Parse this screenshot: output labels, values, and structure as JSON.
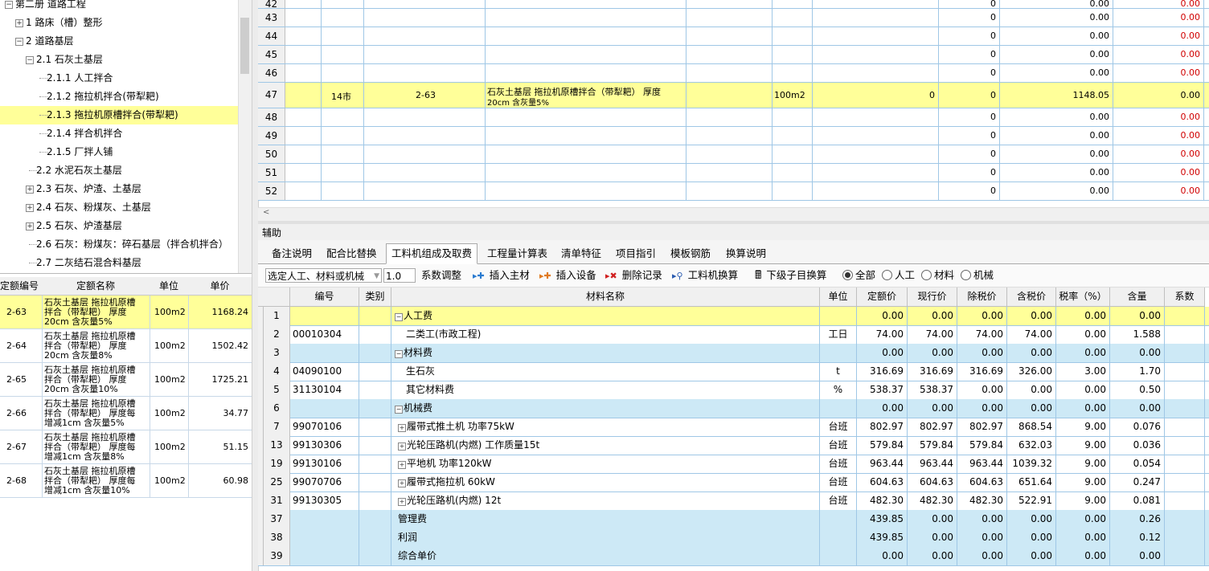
{
  "tree": {
    "items": [
      {
        "label": "第二册 道路工程",
        "expander": "⊟"
      },
      {
        "label": "1 路床（槽）整形",
        "expander": "⊞"
      },
      {
        "label": "2 道路基层",
        "expander": "⊟"
      },
      {
        "label": "2.1 石灰土基层",
        "expander": "⊟"
      },
      {
        "label": "2.1.1 人工拌合",
        "expander": ""
      },
      {
        "label": "2.1.2 拖拉机拌合(带犁耙)",
        "expander": ""
      },
      {
        "label": "2.1.3 拖拉机原槽拌合(带犁耙)",
        "expander": ""
      },
      {
        "label": "2.1.4 拌合机拌合",
        "expander": ""
      },
      {
        "label": "2.1.5 厂拌人铺",
        "expander": ""
      },
      {
        "label": "2.2 水泥石灰土基层",
        "expander": ""
      },
      {
        "label": "2.3 石灰、炉渣、土基层",
        "expander": "⊞"
      },
      {
        "label": "2.4 石灰、粉煤灰、土基层",
        "expander": "⊞"
      },
      {
        "label": "2.5 石灰、炉渣基层",
        "expander": "⊞"
      },
      {
        "label": "2.6 石灰：粉煤灰：碎石基层（拌合机拌合）",
        "expander": ""
      },
      {
        "label": "2.7 二灰结石混合料基层",
        "expander": ""
      }
    ]
  },
  "quota": {
    "headers": [
      "定额编号",
      "定额名称",
      "单位",
      "单价"
    ],
    "rows": [
      {
        "code": "2-63",
        "name1": "石灰土基层 拖拉机原槽",
        "name2": "拌合（带犁耙） 厚度",
        "name3": "20cm 含灰量5%",
        "unit": "100m2",
        "price": "1168.24"
      },
      {
        "code": "2-64",
        "name1": "石灰土基层 拖拉机原槽",
        "name2": "拌合（带犁耙） 厚度",
        "name3": "20cm 含灰量8%",
        "unit": "100m2",
        "price": "1502.42"
      },
      {
        "code": "2-65",
        "name1": "石灰土基层 拖拉机原槽",
        "name2": "拌合（带犁耙） 厚度",
        "name3": "20cm 含灰量10%",
        "unit": "100m2",
        "price": "1725.21"
      },
      {
        "code": "2-66",
        "name1": "石灰土基层 拖拉机原槽",
        "name2": "拌合（带犁耙） 厚度每",
        "name3": "增减1cm 含灰量5%",
        "unit": "100m2",
        "price": "34.77"
      },
      {
        "code": "2-67",
        "name1": "石灰土基层 拖拉机原槽",
        "name2": "拌合（带犁耙） 厚度每",
        "name3": "增减1cm 含灰量8%",
        "unit": "100m2",
        "price": "51.15"
      },
      {
        "code": "2-68",
        "name1": "石灰土基层 拖拉机原槽",
        "name2": "拌合（带犁耙） 厚度每",
        "name3": "增减1cm 含灰量10%",
        "unit": "100m2",
        "price": "60.98"
      }
    ]
  },
  "topgrid": {
    "rows": [
      {
        "num": "42",
        "c1": "",
        "c2": "",
        "c3": "",
        "c4": "",
        "v1": "",
        "v2": "0",
        "v3": "0.00",
        "v4": "0.00",
        "v4red": true
      },
      {
        "num": "43",
        "c1": "",
        "c2": "",
        "c3": "",
        "c4": "",
        "v1": "",
        "v2": "0",
        "v3": "0.00",
        "v4": "0.00",
        "v4red": true
      },
      {
        "num": "44",
        "c1": "",
        "c2": "",
        "c3": "",
        "c4": "",
        "v1": "",
        "v2": "0",
        "v3": "0.00",
        "v4": "0.00",
        "v4red": true
      },
      {
        "num": "45",
        "c1": "",
        "c2": "",
        "c3": "",
        "c4": "",
        "v1": "",
        "v2": "0",
        "v3": "0.00",
        "v4": "0.00",
        "v4red": true
      },
      {
        "num": "46",
        "c1": "",
        "c2": "",
        "c3": "",
        "c4": "",
        "v1": "",
        "v2": "0",
        "v3": "0.00",
        "v4": "0.00",
        "v4red": true
      },
      {
        "num": "47",
        "c1": "14市",
        "c2": "2-63",
        "c3a": "石灰土基层 拖拉机原槽拌合（带犁耙） 厚度",
        "c3b": "20cm 含灰量5%",
        "c4": "100m2",
        "v1": "0",
        "v2": "0",
        "v3": "1148.05",
        "v4": "0.00",
        "v4red": false
      },
      {
        "num": "48",
        "c1": "",
        "c2": "",
        "c3": "",
        "c4": "",
        "v1": "",
        "v2": "0",
        "v3": "0.00",
        "v4": "0.00",
        "v4red": true
      },
      {
        "num": "49",
        "c1": "",
        "c2": "",
        "c3": "",
        "c4": "",
        "v1": "",
        "v2": "0",
        "v3": "0.00",
        "v4": "0.00",
        "v4red": true
      },
      {
        "num": "50",
        "c1": "",
        "c2": "",
        "c3": "",
        "c4": "",
        "v1": "",
        "v2": "0",
        "v3": "0.00",
        "v4": "0.00",
        "v4red": true
      },
      {
        "num": "51",
        "c1": "",
        "c2": "",
        "c3": "",
        "c4": "",
        "v1": "",
        "v2": "0",
        "v3": "0.00",
        "v4": "0.00",
        "v4red": true
      },
      {
        "num": "52",
        "c1": "",
        "c2": "",
        "c3": "",
        "c4": "",
        "v1": "",
        "v2": "0",
        "v3": "0.00",
        "v4": "0.00",
        "v4red": true
      }
    ]
  },
  "aux": {
    "title": "辅助",
    "tabs": [
      "备注说明",
      "配合比替换",
      "工料机组成及取费",
      "工程量计算表",
      "清单特征",
      "项目指引",
      "模板钢筋",
      "换算说明"
    ],
    "active_tab": 2
  },
  "toolbar": {
    "combo_value": "选定人工、材料或机械",
    "coef_value": "1.0",
    "coef_label": "系数调整",
    "insert_main": "插入主材",
    "insert_equip": "插入设备",
    "delete_record": "删除记录",
    "convert": "工料机换算",
    "sub_convert": "下级子目换算",
    "radio_all": "全部",
    "radio_labor": "人工",
    "radio_material": "材料",
    "radio_machine": "机械"
  },
  "matgrid": {
    "headers": [
      "",
      "编号",
      "类别",
      "材料名称",
      "单位",
      "定额价",
      "现行价",
      "除税价",
      "含税价",
      "税率（%）",
      "含量",
      "系数"
    ],
    "rows": [
      {
        "num": "1",
        "code": "",
        "name": "人工费",
        "pm": "⊟",
        "unit": "",
        "p1": "0.00",
        "p2": "0.00",
        "p3": "0.00",
        "p4": "0.00",
        "tax": "0.00",
        "qty": "0.00",
        "type": "sel"
      },
      {
        "num": "2",
        "code": "00010304",
        "name": "二类工(市政工程)",
        "pm": "",
        "unit": "工日",
        "p1": "74.00",
        "p2": "74.00",
        "p3": "74.00",
        "p4": "74.00",
        "tax": "0.00",
        "qty": "1.588",
        "type": ""
      },
      {
        "num": "3",
        "code": "",
        "name": "材料费",
        "pm": "⊟",
        "unit": "",
        "p1": "0.00",
        "p2": "0.00",
        "p3": "0.00",
        "p4": "0.00",
        "tax": "0.00",
        "qty": "0.00",
        "type": "grp"
      },
      {
        "num": "4",
        "code": "04090100",
        "name": "生石灰",
        "pm": "",
        "unit": "t",
        "p1": "316.69",
        "p2": "316.69",
        "p3": "316.69",
        "p4": "326.00",
        "tax": "3.00",
        "qty": "1.70",
        "type": ""
      },
      {
        "num": "5",
        "code": "31130104",
        "name": "其它材料费",
        "pm": "",
        "unit": "%",
        "p1": "538.37",
        "p2": "538.37",
        "p3": "0.00",
        "p4": "0.00",
        "tax": "0.00",
        "qty": "0.50",
        "type": ""
      },
      {
        "num": "6",
        "code": "",
        "name": "机械费",
        "pm": "⊟",
        "unit": "",
        "p1": "0.00",
        "p2": "0.00",
        "p3": "0.00",
        "p4": "0.00",
        "tax": "0.00",
        "qty": "0.00",
        "type": "grp"
      },
      {
        "num": "7",
        "code": "99070106",
        "name": "履带式推土机 功率75kW",
        "pm": "⊞",
        "unit": "台班",
        "p1": "802.97",
        "p2": "802.97",
        "p3": "802.97",
        "p4": "868.54",
        "tax": "9.00",
        "qty": "0.076",
        "type": ""
      },
      {
        "num": "13",
        "code": "99130306",
        "name": "光轮压路机(内燃) 工作质量15t",
        "pm": "⊞",
        "unit": "台班",
        "p1": "579.84",
        "p2": "579.84",
        "p3": "579.84",
        "p4": "632.03",
        "tax": "9.00",
        "qty": "0.036",
        "type": ""
      },
      {
        "num": "19",
        "code": "99130106",
        "name": "平地机 功率120kW",
        "pm": "⊞",
        "unit": "台班",
        "p1": "963.44",
        "p2": "963.44",
        "p3": "963.44",
        "p4": "1039.32",
        "tax": "9.00",
        "qty": "0.054",
        "type": ""
      },
      {
        "num": "25",
        "code": "99070706",
        "name": "履带式拖拉机 60kW",
        "pm": "⊞",
        "unit": "台班",
        "p1": "604.63",
        "p2": "604.63",
        "p3": "604.63",
        "p4": "651.64",
        "tax": "9.00",
        "qty": "0.247",
        "type": ""
      },
      {
        "num": "31",
        "code": "99130305",
        "name": "光轮压路机(内燃) 12t",
        "pm": "⊞",
        "unit": "台班",
        "p1": "482.30",
        "p2": "482.30",
        "p3": "482.30",
        "p4": "522.91",
        "tax": "9.00",
        "qty": "0.081",
        "type": ""
      },
      {
        "num": "37",
        "code": "",
        "name": "管理费",
        "pm": "",
        "unit": "",
        "p1": "439.85",
        "p2": "0.00",
        "p3": "0.00",
        "p4": "0.00",
        "tax": "0.00",
        "qty": "0.26",
        "type": "grp"
      },
      {
        "num": "38",
        "code": "",
        "name": "利润",
        "pm": "",
        "unit": "",
        "p1": "439.85",
        "p2": "0.00",
        "p3": "0.00",
        "p4": "0.00",
        "tax": "0.00",
        "qty": "0.12",
        "type": "grp"
      },
      {
        "num": "39",
        "code": "",
        "name": "综合单价",
        "pm": "",
        "unit": "",
        "p1": "0.00",
        "p2": "0.00",
        "p3": "0.00",
        "p4": "0.00",
        "tax": "0.00",
        "qty": "0.00",
        "type": "grp"
      }
    ]
  },
  "colors": {
    "selected": "#ffff99",
    "group": "#cde9f6",
    "grid_line": "#9fc7e6",
    "red": "#d00000"
  }
}
